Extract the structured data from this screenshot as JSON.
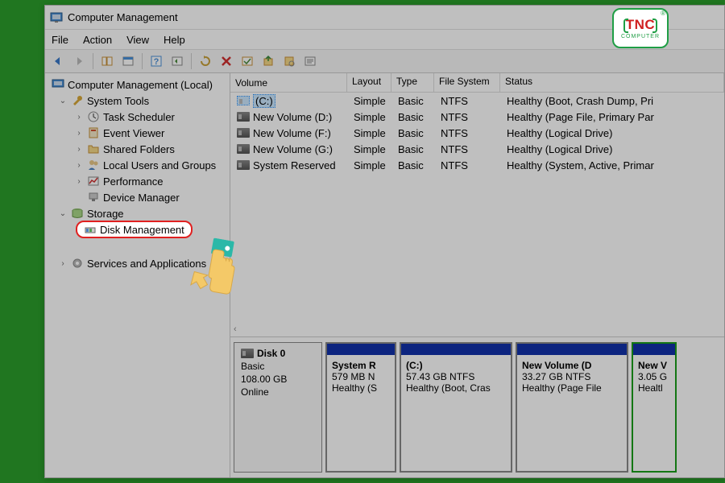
{
  "window": {
    "title": "Computer Management"
  },
  "menu": {
    "file": "File",
    "action": "Action",
    "view": "View",
    "help": "Help"
  },
  "tree": {
    "root": "Computer Management (Local)",
    "system_tools": "System Tools",
    "task_scheduler": "Task Scheduler",
    "event_viewer": "Event Viewer",
    "shared_folders": "Shared Folders",
    "local_users": "Local Users and Groups",
    "performance": "Performance",
    "device_manager": "Device Manager",
    "storage": "Storage",
    "disk_management": "Disk Management",
    "services_apps": "Services and Applications"
  },
  "table": {
    "headers": {
      "volume": "Volume",
      "layout": "Layout",
      "type": "Type",
      "fs": "File System",
      "status": "Status"
    },
    "rows": [
      {
        "name": "(C:)",
        "layout": "Simple",
        "type": "Basic",
        "fs": "NTFS",
        "status": "Healthy (Boot, Crash Dump, Pri"
      },
      {
        "name": "New Volume (D:)",
        "layout": "Simple",
        "type": "Basic",
        "fs": "NTFS",
        "status": "Healthy (Page File, Primary Par"
      },
      {
        "name": "New Volume (F:)",
        "layout": "Simple",
        "type": "Basic",
        "fs": "NTFS",
        "status": "Healthy (Logical Drive)"
      },
      {
        "name": "New Volume (G:)",
        "layout": "Simple",
        "type": "Basic",
        "fs": "NTFS",
        "status": "Healthy (Logical Drive)"
      },
      {
        "name": "System Reserved",
        "layout": "Simple",
        "type": "Basic",
        "fs": "NTFS",
        "status": "Healthy (System, Active, Primar"
      }
    ]
  },
  "disk": {
    "name": "Disk 0",
    "type": "Basic",
    "size": "108.00 GB",
    "state": "Online",
    "partitions": [
      {
        "name": "System R",
        "line2": "579 MB N",
        "line3": "Healthy (S",
        "w": 88
      },
      {
        "name": "(C:)",
        "line2": "57.43 GB NTFS",
        "line3": "Healthy (Boot, Cras",
        "w": 140
      },
      {
        "name": "New Volume   (D",
        "line2": "33.27 GB NTFS",
        "line3": "Healthy (Page File",
        "w": 140
      },
      {
        "name": "New V",
        "line2": "3.05 G",
        "line3": "Healtl",
        "w": 56
      }
    ]
  },
  "logo": {
    "main": "TNC",
    "sub": "COMPUTER"
  }
}
